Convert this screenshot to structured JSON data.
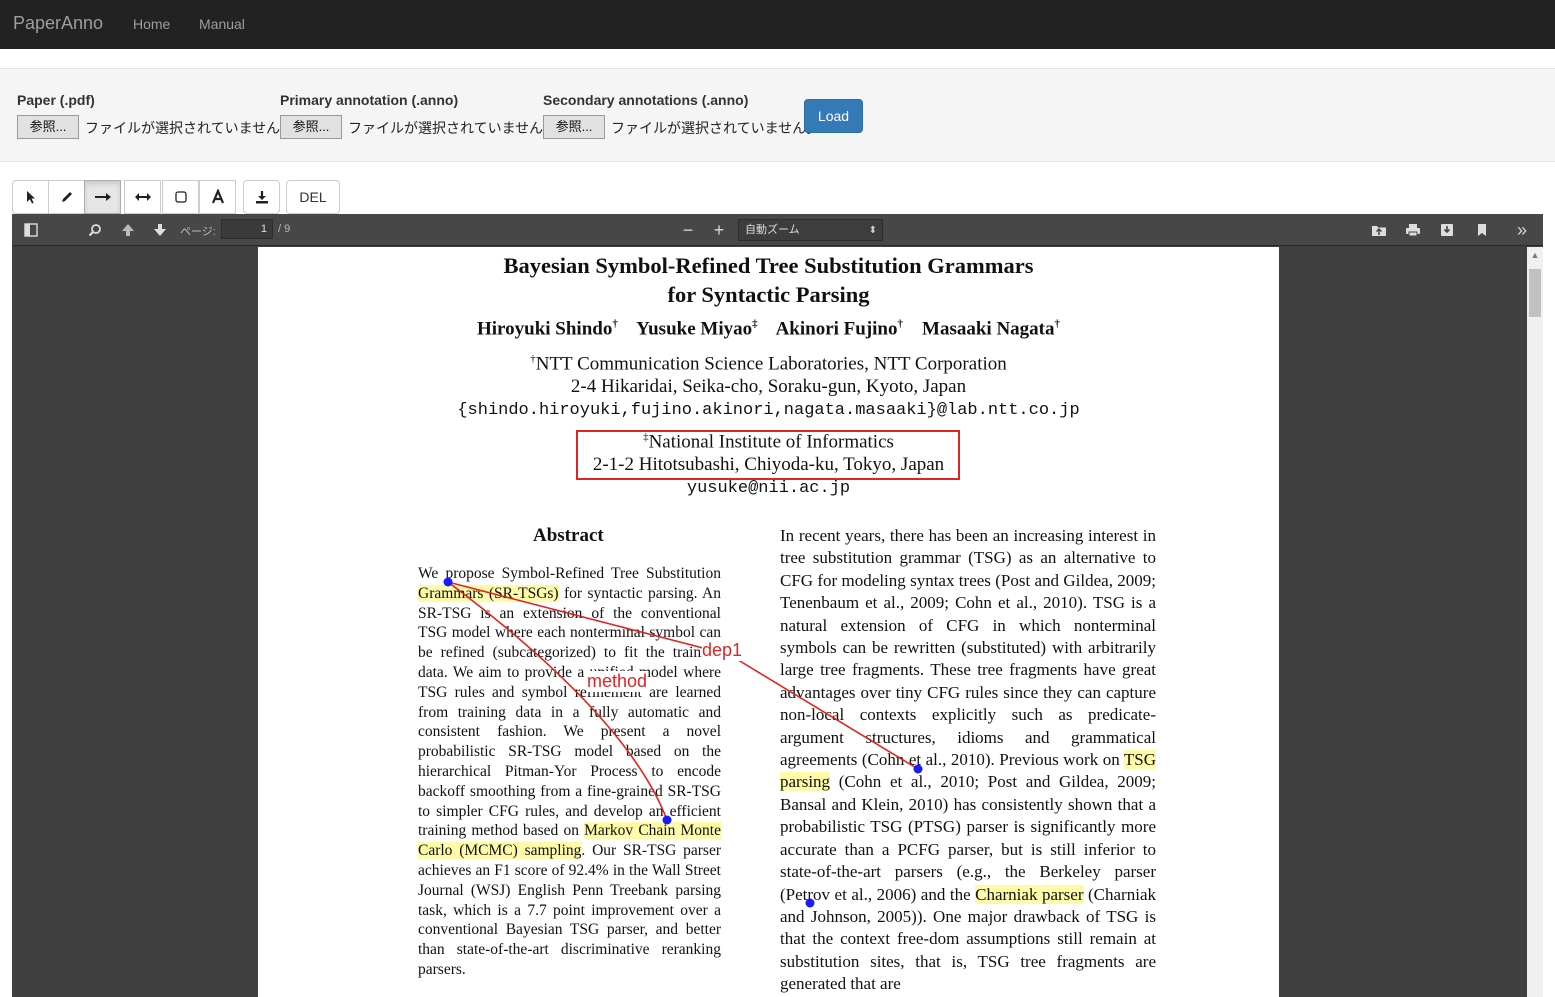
{
  "navbar": {
    "brand": "PaperAnno",
    "links": [
      "Home",
      "Manual"
    ]
  },
  "upload": {
    "fields": [
      {
        "label": "Paper (.pdf)",
        "button": "参照...",
        "status": "ファイルが選択されていません。"
      },
      {
        "label": "Primary annotation (.anno)",
        "button": "参照...",
        "status": "ファイルが選択されていません。"
      },
      {
        "label": "Secondary annotations (.anno)",
        "button": "参照...",
        "status": "ファイルが選択されていません。"
      }
    ],
    "load_label": "Load"
  },
  "toolbar": {
    "tools": [
      "pointer-icon",
      "pencil-icon",
      "arrow-right-icon",
      "double-arrow-icon",
      "rectangle-icon",
      "text-icon",
      "download-icon"
    ],
    "active_tool": "arrow-right-icon",
    "del_label": "DEL"
  },
  "viewer": {
    "page_label": "ページ:",
    "page_current": "1",
    "page_total": "/ 9",
    "zoom": "自動ズーム"
  },
  "paper": {
    "title_line1": "Bayesian Symbol-Refined Tree Substitution Grammars",
    "title_line2": "for Syntactic Parsing",
    "authors": [
      {
        "name": "Hiroyuki Shindo",
        "mark": "†"
      },
      {
        "name": "Yusuke Miyao",
        "mark": "‡"
      },
      {
        "name": "Akinori Fujino",
        "mark": "†"
      },
      {
        "name": "Masaaki Nagata",
        "mark": "†"
      }
    ],
    "aff1_mark": "†",
    "aff1_line1": "NTT Communication Science Laboratories, NTT Corporation",
    "aff1_line2": "2-4 Hikaridai, Seika-cho, Soraku-gun, Kyoto, Japan",
    "aff1_email": "{shindo.hiroyuki,fujino.akinori,nagata.masaaki}@lab.ntt.co.jp",
    "aff2_mark": "‡",
    "aff2_line1": "National Institute of Informatics",
    "aff2_line2": "2-1-2 Hitotsubashi, Chiyoda-ku, Tokyo, Japan",
    "aff2_email": "yusuke@nii.ac.jp",
    "abstract_heading": "Abstract",
    "abstract_parts": [
      "We propose Symbol-Refined Tree Substitution ",
      "Grammars (SR-TSGs)",
      " for syntactic parsing. An SR-TSG is an extension of the conventional TSG model where each nonterminal symbol can be refined (subcategorized) to fit the training data. We aim to provide a unified model where TSG rules and symbol refinement are learned from training data in a fully automatic and consistent fashion. We present a novel probabilistic SR-TSG model based on the hierarchical Pitman-Yor Process to encode backoff smoothing from a fine-grained SR-TSG to simpler CFG rules, and develop an efficient training method based on ",
      "Markov Chain Monte Carlo (MCMC) sampling",
      ". Our SR-TSG parser achieves an F1 score of 92.4% in the Wall Street Journal (WSJ) English Penn Treebank parsing task, which is a 7.7 point improvement over a conventional Bayesian TSG parser, and better than state-of-the-art discriminative reranking parsers."
    ],
    "intro_parts": [
      "In recent years, there has been an increasing interest in tree substitution grammar (TSG) as an alternative to CFG for modeling syntax trees (Post and Gildea, 2009; Tenenbaum et al., 2009; Cohn et al., 2010). TSG is a natural extension of CFG in which nonterminal symbols can be rewritten (substituted) with arbitrarily large tree fragments. These tree fragments have great advantages over tiny CFG rules since they can capture non-local contexts explicitly such as predicate-argument structures, idioms and grammatical agreements (Cohn et al., 2010). Previous work on ",
      "TSG parsing",
      " (Cohn et al., 2010; Post and Gildea, 2009; Bansal and Klein, 2010) has consistently shown that a probabilistic TSG (PTSG) parser is significantly more accurate than a PCFG parser, but is still inferior to state-of-the-art parsers (e.g., the Berkeley parser (Petrov et al., 2006) and the ",
      "Charniak parser",
      " (Charniak and Johnson, 2005)). One major drawback of TSG is that the context free-dom assumptions still remain at substitution sites, that is, TSG tree fragments are generated that are"
    ]
  },
  "annotations": {
    "labels": [
      "dep1",
      "method"
    ],
    "color": "#e02424",
    "highlight_color": "#fdfaa8",
    "node_color": "#1a1aff"
  }
}
